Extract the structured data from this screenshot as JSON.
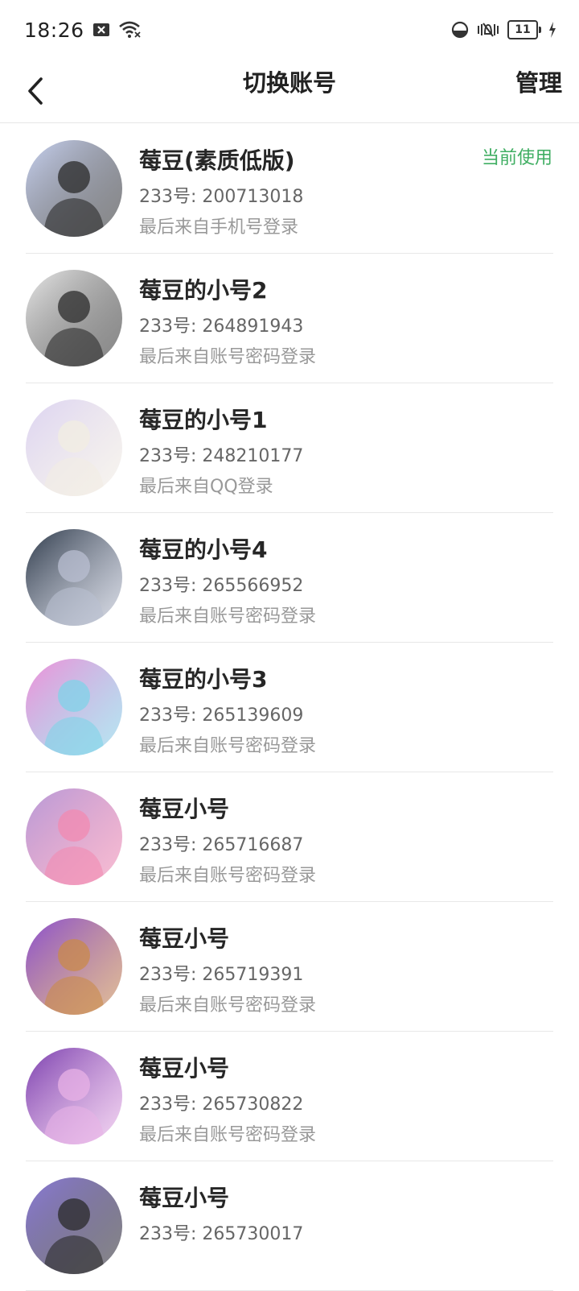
{
  "status_bar": {
    "time": "18:26",
    "battery": "11",
    "icons": [
      "notification-x-icon",
      "wifi-icon",
      "data-saver-icon",
      "vibrate-icon",
      "battery-icon",
      "charging-icon"
    ]
  },
  "header": {
    "title": "切换账号",
    "manage_label": "管理",
    "back_icon": "chevron-left-icon"
  },
  "accounts": [
    {
      "name": "莓豆(素质低版)",
      "uid": "233号: 200713018",
      "login": "最后来自手机号登录",
      "current": "当前使用",
      "avatar_colors": [
        "#c9d3f2",
        "#2a2a2a"
      ]
    },
    {
      "name": "莓豆的小号2",
      "uid": "233号: 264891943",
      "login": "最后来自账号密码登录",
      "avatar_colors": [
        "#e9e9e9",
        "#2b2b2b"
      ]
    },
    {
      "name": "莓豆的小号1",
      "uid": "233号: 248210177",
      "login": "最后来自QQ登录",
      "avatar_colors": [
        "#dcd3f2",
        "#f2ede2"
      ]
    },
    {
      "name": "莓豆的小号4",
      "uid": "233号: 265566952",
      "login": "最后来自账号密码登录",
      "avatar_colors": [
        "#2e3a4a",
        "#b9bfd1"
      ]
    },
    {
      "name": "莓豆的小号3",
      "uid": "233号: 265139609",
      "login": "最后来自账号密码登录",
      "avatar_colors": [
        "#f08fd8",
        "#7fd3e8"
      ]
    },
    {
      "name": "莓豆小号",
      "uid": "233号: 265716687",
      "login": "最后来自账号密码登录",
      "avatar_colors": [
        "#b79ad8",
        "#f28ab0"
      ]
    },
    {
      "name": "莓豆小号",
      "uid": "233号: 265719391",
      "login": "最后来自账号密码登录",
      "avatar_colors": [
        "#8a4fd0",
        "#c98a4a"
      ]
    },
    {
      "name": "莓豆小号",
      "uid": "233号: 265730822",
      "login": "最后来自账号密码登录",
      "avatar_colors": [
        "#7a3fae",
        "#e8b2e6"
      ]
    },
    {
      "name": "莓豆小号",
      "uid": "233号: 265730017",
      "login": "",
      "avatar_colors": [
        "#8b7ad8",
        "#2a2a2a"
      ]
    }
  ],
  "colors": {
    "current_green": "#3fae62",
    "divider": "#e8e8e8"
  }
}
